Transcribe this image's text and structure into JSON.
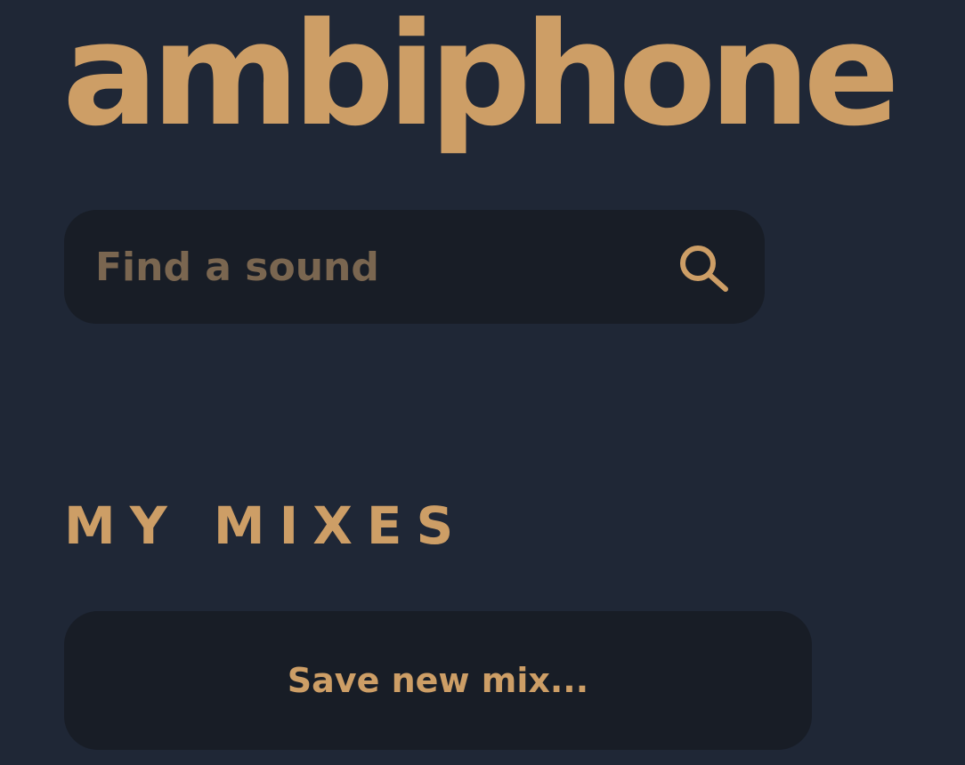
{
  "app": {
    "logo": "ambiphone"
  },
  "search": {
    "placeholder": "Find a sound",
    "value": "",
    "icon": "search-icon"
  },
  "mixes": {
    "title": "MY MIXES",
    "save_label": "Save new mix..."
  },
  "colors": {
    "background": "#1f2736",
    "panel": "#181d26",
    "accent": "#cd9e66",
    "placeholder": "#7a6650"
  }
}
